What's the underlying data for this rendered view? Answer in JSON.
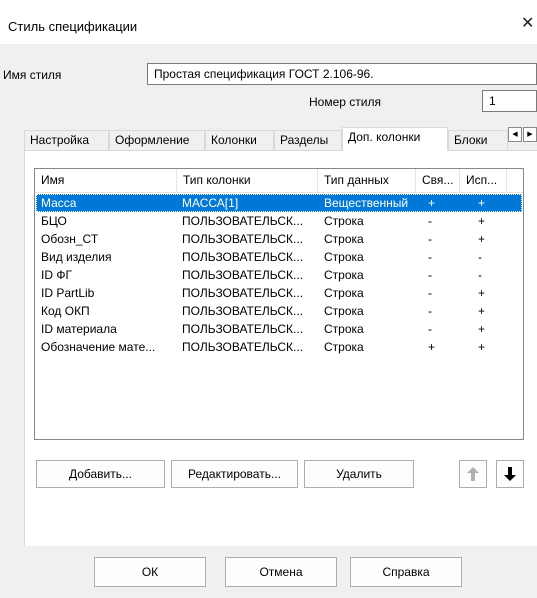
{
  "window": {
    "title": "Стиль спецификации",
    "close_glyph": "✕"
  },
  "style_name": {
    "label": "Имя стиля",
    "value": "Простая спецификация ГОСТ 2.106-96."
  },
  "style_number": {
    "label": "Номер стиля",
    "value": "1"
  },
  "tabs": [
    {
      "label": "Настройка"
    },
    {
      "label": "Оформление"
    },
    {
      "label": "Колонки"
    },
    {
      "label": "Разделы"
    },
    {
      "label": "Доп. колонки",
      "active": true
    },
    {
      "label": "Блоки"
    }
  ],
  "tab_scroll": {
    "left_glyph": "◀",
    "right_glyph": "▶"
  },
  "table": {
    "columns": [
      "Имя",
      "Тип колонки",
      "Тип данных",
      "Свя...",
      "Исп..."
    ],
    "rows": [
      [
        "Масса",
        "МАССА[1]",
        "Вещественный",
        "+",
        "+"
      ],
      [
        "БЦО",
        "ПОЛЬЗОВАТЕЛЬСК...",
        "Строка",
        "-",
        "+"
      ],
      [
        "Обозн_СТ",
        "ПОЛЬЗОВАТЕЛЬСК...",
        "Строка",
        "-",
        "+"
      ],
      [
        "Вид изделия",
        "ПОЛЬЗОВАТЕЛЬСК...",
        "Строка",
        "-",
        "-"
      ],
      [
        "ID ФГ",
        "ПОЛЬЗОВАТЕЛЬСК...",
        "Строка",
        "-",
        "-"
      ],
      [
        "ID PartLib",
        "ПОЛЬЗОВАТЕЛЬСК...",
        "Строка",
        "-",
        "+"
      ],
      [
        "Код ОКП",
        "ПОЛЬЗОВАТЕЛЬСК...",
        "Строка",
        "-",
        "+"
      ],
      [
        "ID материала",
        "ПОЛЬЗОВАТЕЛЬСК...",
        "Строка",
        "-",
        "+"
      ],
      [
        "Обозначение мате...",
        "ПОЛЬЗОВАТЕЛЬСК...",
        "Строка",
        "+",
        "+"
      ]
    ],
    "selected_row": 0
  },
  "list_buttons": {
    "add": "Добавить...",
    "edit": "Редактировать...",
    "delete": "Удалить"
  },
  "move_buttons": {
    "up_icon": "arrow-up-icon",
    "down_icon": "arrow-down-icon"
  },
  "footer": {
    "ok": "ОК",
    "cancel": "Отмена",
    "help": "Справка"
  },
  "colors": {
    "selection": "#0078d7",
    "dialog_bg": "#f0f0f0",
    "disabled": "#b0b0b0"
  }
}
